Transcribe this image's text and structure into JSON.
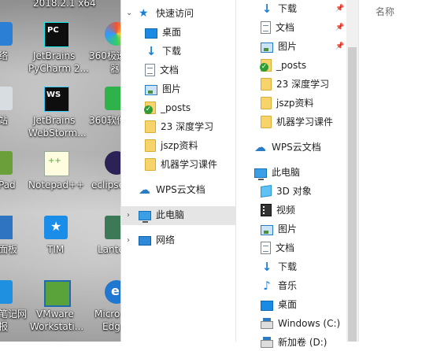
{
  "desktop": {
    "top_text": "2018.2.1 x64",
    "icons": [
      {
        "name": "jetbrains-pycharm",
        "label1": "JetBrains",
        "label2": "PyCharm 2..."
      },
      {
        "name": "360-security",
        "label1": "360极速",
        "label2": "器"
      },
      {
        "name": "jetbrains-webstorm",
        "label1": "JetBrains",
        "label2": "WebStorm..."
      },
      {
        "name": "360-software",
        "label1": "360软件"
      },
      {
        "name": "notepad-plus",
        "label1": "Notepad++"
      },
      {
        "name": "eclipse",
        "label1": "eclipse"
      },
      {
        "name": "tim",
        "label1": "TIM"
      },
      {
        "name": "lantern",
        "label1": "Lante"
      },
      {
        "name": "vmware",
        "label1": "VMware",
        "label2": "Workstati..."
      },
      {
        "name": "edge",
        "label1": "Micro",
        "label2": "Edg"
      }
    ],
    "left_partials": [
      "络",
      "站",
      "Pad",
      "面板",
      "笔记网",
      "报"
    ]
  },
  "nav": {
    "quick_access": "快速访问",
    "items": [
      {
        "label": "桌面",
        "icon": "desktop-icon"
      },
      {
        "label": "下载",
        "icon": "download-icon"
      },
      {
        "label": "文档",
        "icon": "document-icon"
      },
      {
        "label": "图片",
        "icon": "picture-icon"
      },
      {
        "label": "_posts",
        "icon": "sync-folder-icon"
      },
      {
        "label": "23 深度学习",
        "icon": "folder-icon"
      },
      {
        "label": "jszp资料",
        "icon": "folder-icon"
      },
      {
        "label": "机器学习课件",
        "icon": "folder-icon"
      }
    ],
    "wps": "WPS云文档",
    "this_pc": "此电脑",
    "network": "网络"
  },
  "pane2": {
    "quick": [
      {
        "label": "下载",
        "icon": "download-icon",
        "pinned": true
      },
      {
        "label": "文档",
        "icon": "document-icon",
        "pinned": true
      },
      {
        "label": "图片",
        "icon": "picture-icon",
        "pinned": true
      },
      {
        "label": "_posts",
        "icon": "sync-folder-icon"
      },
      {
        "label": "23 深度学习",
        "icon": "folder-icon"
      },
      {
        "label": "jszp资料",
        "icon": "folder-icon"
      },
      {
        "label": "机器学习课件",
        "icon": "folder-icon"
      }
    ],
    "wps": "WPS云文档",
    "this_pc": "此电脑",
    "pc_items": [
      {
        "label": "3D 对象",
        "icon": "3d-objects-icon"
      },
      {
        "label": "视频",
        "icon": "video-icon"
      },
      {
        "label": "图片",
        "icon": "picture-icon"
      },
      {
        "label": "文档",
        "icon": "document-icon"
      },
      {
        "label": "下载",
        "icon": "download-icon"
      },
      {
        "label": "音乐",
        "icon": "music-icon"
      },
      {
        "label": "桌面",
        "icon": "desktop-icon"
      },
      {
        "label": "Windows (C:)",
        "icon": "drive-icon"
      },
      {
        "label": "新加卷 (D:)",
        "icon": "drive-icon"
      }
    ]
  },
  "content": {
    "name_header": "名称"
  }
}
